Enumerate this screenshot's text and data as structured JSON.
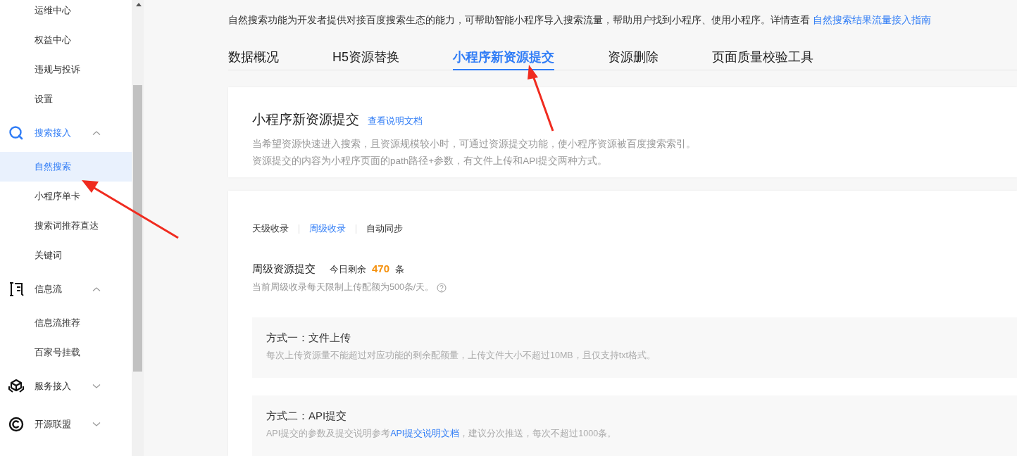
{
  "sidebar": {
    "items": [
      {
        "kind": "link",
        "label": "运维中心",
        "selected": false
      },
      {
        "kind": "link",
        "label": "权益中心",
        "selected": false
      },
      {
        "kind": "link",
        "label": "违规与投诉",
        "selected": false
      },
      {
        "kind": "link",
        "label": "设置",
        "selected": false
      },
      {
        "kind": "group",
        "label": "搜索接入",
        "expanded": true,
        "selected": true,
        "children": [
          {
            "label": "自然搜索",
            "selected": true
          },
          {
            "label": "小程序单卡",
            "selected": false
          },
          {
            "label": "搜索词推荐直达",
            "selected": false
          },
          {
            "label": "关键词",
            "selected": false
          }
        ]
      },
      {
        "kind": "group",
        "label": "信息流",
        "expanded": true,
        "selected": false,
        "children": [
          {
            "label": "信息流推荐",
            "selected": false
          },
          {
            "label": "百家号挂载",
            "selected": false
          }
        ]
      },
      {
        "kind": "group",
        "label": "服务接入",
        "expanded": false,
        "selected": false
      },
      {
        "kind": "group",
        "label": "开源联盟",
        "expanded": false,
        "selected": false
      }
    ]
  },
  "intro": {
    "text": "自然搜索功能为开发者提供对接百度搜索生态的能力，可帮助智能小程序导入搜索流量，帮助用户找到小程序、使用小程序。详情查看",
    "link": "自然搜索结果流量接入指南"
  },
  "tabs": [
    {
      "label": "数据概况",
      "selected": false
    },
    {
      "label": "H5资源替换",
      "selected": false
    },
    {
      "label": "小程序新资源提交",
      "selected": true
    },
    {
      "label": "资源删除",
      "selected": false
    },
    {
      "label": "页面质量校验工具",
      "selected": false
    }
  ],
  "header_card": {
    "title": "小程序新资源提交",
    "link": "查看说明文档",
    "lines": [
      "当希望资源快速进入搜索，且资源规模较小时，可通过资源提交功能，使小程序资源被百度搜索索引。",
      "资源提交的内容为小程序页面的path路径+参数，有文件上传和API提交两种方式。"
    ]
  },
  "sub_tabs": [
    {
      "label": "天级收录",
      "selected": false
    },
    {
      "label": "周级收录",
      "selected": true
    },
    {
      "label": "自动同步",
      "selected": false
    }
  ],
  "quota": {
    "title": "周级资源提交",
    "remaining_label": "今日剩余",
    "remaining": "470",
    "unit": "条",
    "note": "当前周级收录每天限制上传配额为500条/天。"
  },
  "methods": [
    {
      "title": "方式一：文件上传",
      "parts": [
        {
          "kind": "text",
          "text": "每次上传资源量不能超过对应功能的剩余配额量，上传文件大小不超过10MB，且仅支持txt格式。"
        }
      ]
    },
    {
      "title": "方式二：API提交",
      "parts": [
        {
          "kind": "text",
          "text": "API提交的参数及提交说明参考"
        },
        {
          "kind": "link",
          "text": "API提交说明文档"
        },
        {
          "kind": "text",
          "text": "，建议分次推送，每次不超过1000条。"
        }
      ]
    }
  ]
}
